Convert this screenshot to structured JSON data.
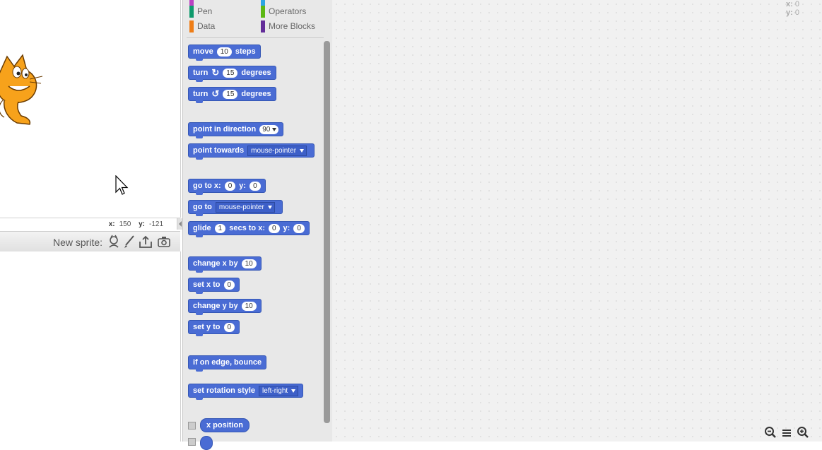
{
  "stage": {
    "mouse_x_label": "x:",
    "mouse_x": "150",
    "mouse_y_label": "y:",
    "mouse_y": "-121",
    "sprite_name": "cat-sprite"
  },
  "sprite_bar": {
    "label": "New sprite:",
    "icons": [
      "sprite-library-icon",
      "paint-brush-icon",
      "upload-icon",
      "camera-icon"
    ]
  },
  "categories": [
    {
      "label": "Pen",
      "color": "#0e9a6c"
    },
    {
      "label": "Operators",
      "color": "#5cb712"
    },
    {
      "label": "Data",
      "color": "#ee7d16"
    },
    {
      "label": "More Blocks",
      "color": "#632d99"
    }
  ],
  "blocks": {
    "move": {
      "w1": "move",
      "n1": "10",
      "w2": "steps"
    },
    "turn_right": {
      "w1": "turn",
      "n1": "15",
      "w2": "degrees"
    },
    "turn_left": {
      "w1": "turn",
      "n1": "15",
      "w2": "degrees"
    },
    "point_dir": {
      "w1": "point in direction",
      "n1": "90"
    },
    "point_towards": {
      "w1": "point towards",
      "d1": "mouse-pointer"
    },
    "goto_xy": {
      "w1": "go to x:",
      "n1": "0",
      "w2": "y:",
      "n2": "0"
    },
    "goto": {
      "w1": "go to",
      "d1": "mouse-pointer"
    },
    "glide": {
      "w1": "glide",
      "n1": "1",
      "w2": "secs to x:",
      "n2": "0",
      "w3": "y:",
      "n3": "0"
    },
    "change_x": {
      "w1": "change x by",
      "n1": "10"
    },
    "set_x": {
      "w1": "set x to",
      "n1": "0"
    },
    "change_y": {
      "w1": "change y by",
      "n1": "10"
    },
    "set_y": {
      "w1": "set y to",
      "n1": "0"
    },
    "bounce": {
      "w1": "if on edge, bounce"
    },
    "rotation": {
      "w1": "set rotation style",
      "d1": "left-right"
    },
    "x_position": {
      "w1": "x position"
    }
  },
  "scripts_area": {
    "x_label": "x:",
    "x": "0",
    "y_label": "y:",
    "y": "0"
  },
  "colors": {
    "motion": "#4a6cd4",
    "palette_bg": "#e8e8e8"
  }
}
